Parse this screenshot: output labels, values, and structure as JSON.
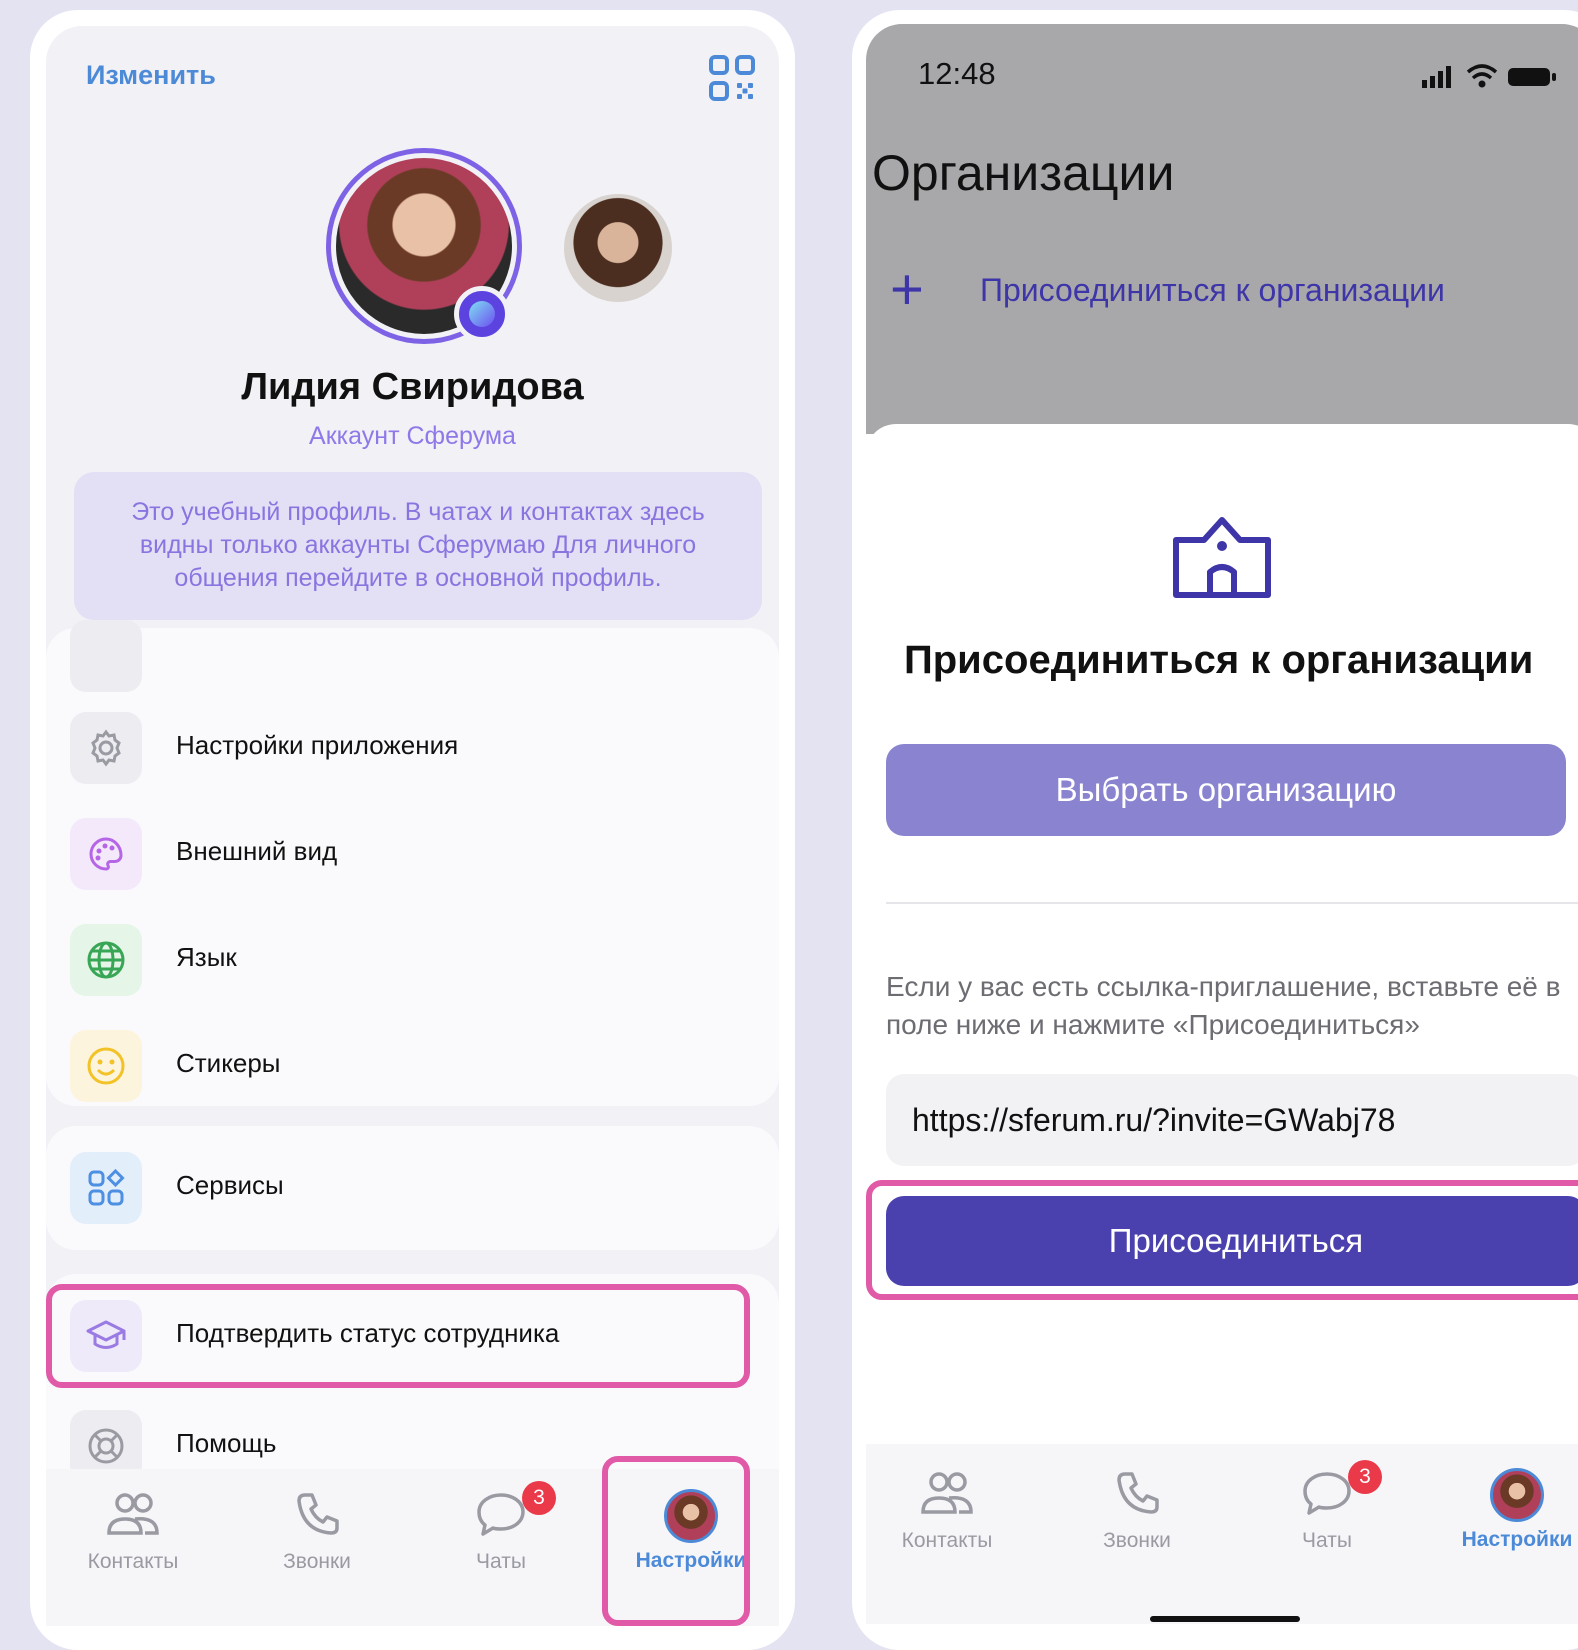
{
  "left_screen": {
    "header": {
      "edit_label": "Изменить",
      "qr_icon": "qr-code-icon"
    },
    "profile": {
      "name": "Лидия Свиридова",
      "account_type": "Аккаунт Сферума",
      "info_text": "Это учебный профиль. В чатах и контактах здесь видны только аккаунты Сферумаю Для личного общения перейдите в основной профиль."
    },
    "menu": [
      {
        "label": "Настройки приложения",
        "icon": "gear-icon",
        "icon_bg": "#ececf1",
        "icon_color": "#9a9aa3"
      },
      {
        "label": "Внешний вид",
        "icon": "palette-icon",
        "icon_bg": "#f3e9fb",
        "icon_color": "#b665e6"
      },
      {
        "label": "Язык",
        "icon": "globe-icon",
        "icon_bg": "#e5f5e8",
        "icon_color": "#38a654"
      },
      {
        "label": "Стикеры",
        "icon": "smile-icon",
        "icon_bg": "#fdf4dd",
        "icon_color": "#f2c227"
      }
    ],
    "services": {
      "label": "Сервисы",
      "icon": "grid-icon",
      "icon_bg": "#e3eefb",
      "icon_color": "#4d8fe3"
    },
    "confirm_status": {
      "label": "Подтвердить статус сотрудника",
      "icon": "graduation-cap-icon",
      "icon_bg": "#eeeaf9",
      "icon_color": "#9a7ae3"
    },
    "help": {
      "label": "Помощь",
      "icon": "lifebuoy-icon"
    },
    "tabs": [
      {
        "label": "Контакты",
        "icon": "contacts-icon"
      },
      {
        "label": "Звонки",
        "icon": "phone-icon"
      },
      {
        "label": "Чаты",
        "icon": "chat-icon",
        "badge": "3"
      },
      {
        "label": "Настройки",
        "icon": "avatar-icon",
        "active": true
      }
    ]
  },
  "right_screen": {
    "status_bar": {
      "time": "12:48"
    },
    "page_title": "Организации",
    "join_link": "Присоединиться к организации",
    "sheet": {
      "title": "Присоединиться к организации",
      "choose_button": "Выбрать организацию",
      "hint": "Если у вас есть ссылка-приглашение, вставьте её в поле ниже и нажмите «Присоединиться»",
      "invite_value": "https://sferum.ru/?invite=GWabj78",
      "join_button": "Присоединиться"
    },
    "tabs": [
      {
        "label": "Контакты",
        "icon": "contacts-icon"
      },
      {
        "label": "Звонки",
        "icon": "phone-icon"
      },
      {
        "label": "Чаты",
        "icon": "chat-icon",
        "badge": "3"
      },
      {
        "label": "Настройки",
        "icon": "avatar-icon",
        "active": true
      }
    ]
  },
  "colors": {
    "accent": "#4a41ae",
    "link_blue": "#4c8ad8",
    "sferum_purple": "#8f78e8",
    "highlight_pink": "#e05aa8",
    "badge_red": "#ea3949"
  }
}
